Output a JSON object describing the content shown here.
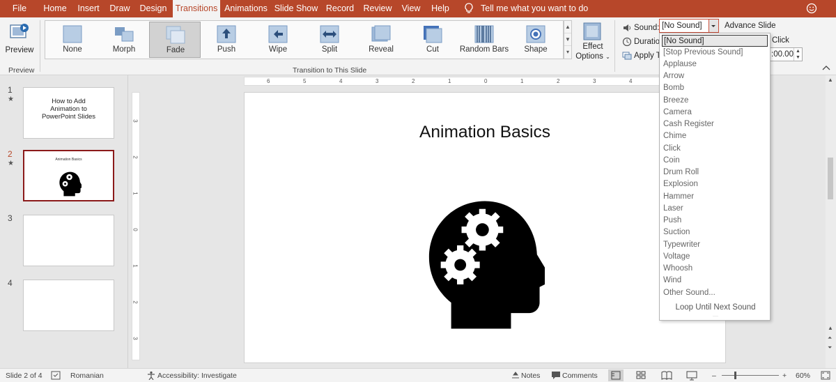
{
  "tabs": [
    {
      "label": "File",
      "active": false
    },
    {
      "label": "Home",
      "active": false
    },
    {
      "label": "Insert",
      "active": false
    },
    {
      "label": "Draw",
      "active": false
    },
    {
      "label": "Design",
      "active": false
    },
    {
      "label": "Transitions",
      "active": true
    },
    {
      "label": "Animations",
      "active": false
    },
    {
      "label": "Slide Show",
      "active": false
    },
    {
      "label": "Record",
      "active": false
    },
    {
      "label": "Review",
      "active": false
    },
    {
      "label": "View",
      "active": false
    },
    {
      "label": "Help",
      "active": false
    }
  ],
  "tell_me": "Tell me what you want to do",
  "ribbon": {
    "preview_label": "Preview",
    "preview_group": "Preview",
    "transition_group": "Transition to This Slide",
    "transitions": [
      {
        "name": "None"
      },
      {
        "name": "Morph"
      },
      {
        "name": "Fade"
      },
      {
        "name": "Push"
      },
      {
        "name": "Wipe"
      },
      {
        "name": "Split"
      },
      {
        "name": "Reveal"
      },
      {
        "name": "Cut"
      },
      {
        "name": "Random Bars"
      },
      {
        "name": "Shape"
      }
    ],
    "selected_transition": "Fade",
    "effect_options_line1": "Effect",
    "effect_options_line2": "Options",
    "sound_label": "Sound:",
    "sound_value": "[No Sound]",
    "duration_label": "Duratio",
    "apply_label": "Apply T",
    "advance_slide": "Advance Slide",
    "on_click_fragment": "Click",
    "after_value_fragment": ":00.00"
  },
  "sound_options": [
    "[No Sound]",
    "[Stop Previous Sound]",
    "Applause",
    "Arrow",
    "Bomb",
    "Breeze",
    "Camera",
    "Cash Register",
    "Chime",
    "Click",
    "Coin",
    "Drum Roll",
    "Explosion",
    "Hammer",
    "Laser",
    "Push",
    "Suction",
    "Typewriter",
    "Voltage",
    "Whoosh",
    "Wind",
    "Other Sound..."
  ],
  "loop_until_next": "Loop Until Next Sound",
  "slides": [
    {
      "number": "1",
      "title": "How to Add Animation to PowerPoint Slides",
      "has_star": true
    },
    {
      "number": "2",
      "title": "Animation Basics",
      "has_star": true
    },
    {
      "number": "3",
      "title": "",
      "has_star": false
    },
    {
      "number": "4",
      "title": "",
      "has_star": false
    }
  ],
  "current_slide_title": "Animation Basics",
  "ruler_h": [
    "6",
    "5",
    "4",
    "3",
    "2",
    "1",
    "0",
    "1",
    "2",
    "3",
    "4"
  ],
  "ruler_v": [
    "3",
    "2",
    "1",
    "0",
    "1",
    "2",
    "3"
  ],
  "status": {
    "slide_counter": "Slide 2 of 4",
    "language": "Romanian",
    "accessibility": "Accessibility: Investigate",
    "notes": "Notes",
    "comments": "Comments",
    "zoom_minus": "–",
    "zoom_plus": "+",
    "zoom": "60%"
  },
  "colors": {
    "accent": "#b7472a",
    "selected_thumb_border": "#8b1a1a"
  }
}
